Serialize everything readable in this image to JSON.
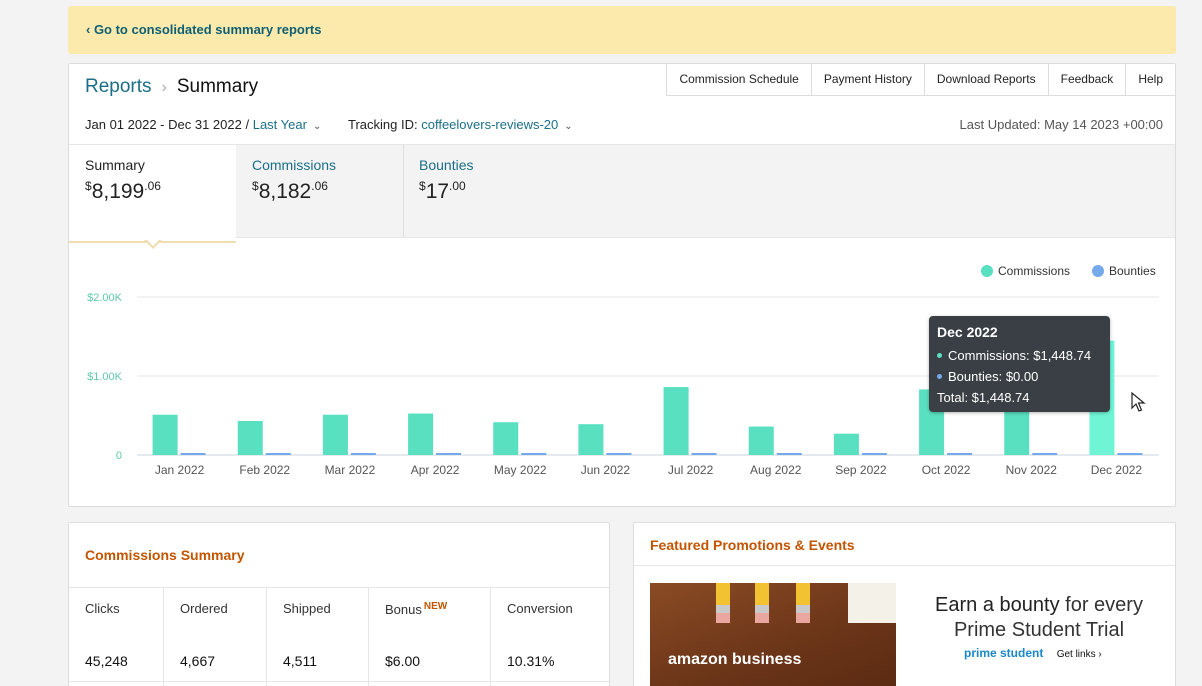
{
  "banner": {
    "link": "‹ Go to consolidated summary reports"
  },
  "breadcrumb": {
    "root": "Reports",
    "separator": "›",
    "current": "Summary"
  },
  "topnav": [
    "Commission Schedule",
    "Payment History",
    "Download Reports",
    "Feedback",
    "Help"
  ],
  "filters": {
    "date_range": "Jan 01 2022 - Dec 31 2022",
    "slash": "/",
    "period": "Last Year",
    "tracking_label": "Tracking ID:",
    "tracking_id": "coffeelovers-reviews-20",
    "last_updated": "Last Updated: May 14 2023 +00:00"
  },
  "tabs": [
    {
      "label": "Summary",
      "currency": "$",
      "whole": "8,199",
      "cents": ".06"
    },
    {
      "label": "Commissions",
      "currency": "$",
      "whole": "8,182",
      "cents": ".06"
    },
    {
      "label": "Bounties",
      "currency": "$",
      "whole": "17",
      "cents": ".00"
    }
  ],
  "colors": {
    "commissions": "#58e0c0",
    "commissions_hover": "#6ff5d6",
    "bounties": "#74a9ea",
    "axis_text": "#5fc9ab",
    "link": "#1a6f87",
    "accent_orange": "#c45500"
  },
  "chart_data": {
    "type": "bar",
    "categories": [
      "Jan 2022",
      "Feb 2022",
      "Mar 2022",
      "Apr 2022",
      "May 2022",
      "Jun 2022",
      "Jul 2022",
      "Aug 2022",
      "Sep 2022",
      "Oct 2022",
      "Nov 2022",
      "Dec 2022"
    ],
    "series": [
      {
        "name": "Commissions",
        "values": [
          510,
          430,
          510,
          525,
          415,
          390,
          860,
          360,
          270,
          830,
          1075,
          1448.74
        ]
      },
      {
        "name": "Bounties",
        "values": [
          17,
          0,
          0,
          0,
          0,
          0,
          0,
          0,
          0,
          0,
          0,
          0
        ]
      }
    ],
    "yticks": [
      "0",
      "$1.00K",
      "$2.00K"
    ],
    "ylim": [
      0,
      2000
    ],
    "grid": true,
    "legend": "top-right",
    "tooltip": {
      "title": "Dec 2022",
      "rows": [
        "Commissions: $1,448.74",
        "Bounties: $0.00"
      ],
      "total": "Total: $1,448.74"
    }
  },
  "commissions_summary": {
    "title": "Commissions Summary",
    "stats": [
      {
        "label": "Clicks",
        "value": "45,248",
        "badge": ""
      },
      {
        "label": "Ordered",
        "value": "4,667",
        "badge": ""
      },
      {
        "label": "Shipped",
        "value": "4,511",
        "badge": ""
      },
      {
        "label": "Bonus",
        "value": "$6.00",
        "badge": "NEW"
      },
      {
        "label": "Conversion",
        "value": "10.31%",
        "badge": ""
      }
    ]
  },
  "promotions": {
    "title": "Featured Promotions & Events",
    "image_brand": "amazon business",
    "headline_1": "Earn a bounty",
    "headline_2": "for every",
    "headline_3": "Prime Student Trial",
    "brand": "prime student",
    "get_links": "Get links ›"
  }
}
